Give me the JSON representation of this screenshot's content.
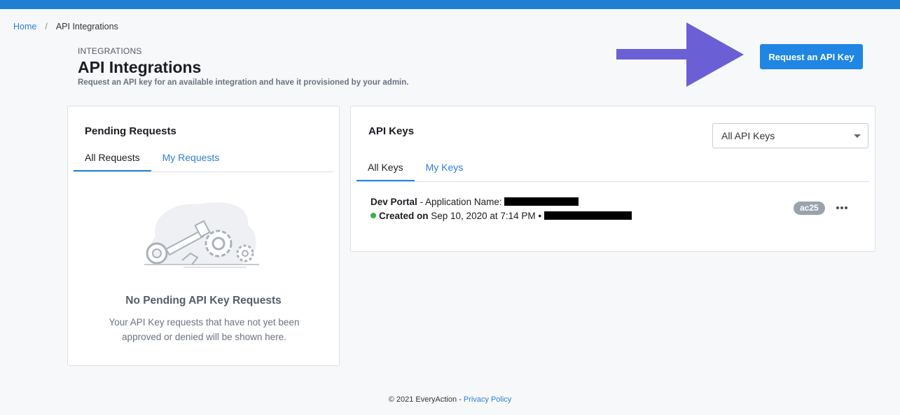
{
  "breadcrumb": {
    "home": "Home",
    "separator": "/",
    "current": "API Integrations"
  },
  "header": {
    "eyebrow": "INTEGRATIONS",
    "title": "API Integrations",
    "subtitle": "Request an API key for an available integration and have it provisioned by your admin."
  },
  "actions": {
    "request_button": "Request an API Key"
  },
  "pending": {
    "title": "Pending Requests",
    "tabs": [
      {
        "label": "All Requests"
      },
      {
        "label": "My Requests"
      }
    ],
    "empty_title": "No Pending API Key Requests",
    "empty_desc": "Your API Key requests that have not yet been approved or denied will be shown here."
  },
  "keys": {
    "title": "API Keys",
    "filter": {
      "selected": "All API Keys"
    },
    "tabs": [
      {
        "label": "All Keys"
      },
      {
        "label": "My Keys"
      }
    ],
    "items": [
      {
        "name": "Dev Portal",
        "app_label": " - Application Name: ",
        "created_label": "Created on",
        "created_date": " Sep 10, 2020 at 7:14 PM • ",
        "badge": "ac25"
      }
    ]
  },
  "footer": {
    "copyright": "© 2021 EveryAction - ",
    "privacy": "Privacy Policy"
  },
  "colors": {
    "topbar": "#1e7fd3",
    "primary": "#1f86e3",
    "arrow": "#6b5fd6",
    "status_active": "#36b24a",
    "badge": "#9aa3ad"
  },
  "icons": [
    "arrow-right-icon",
    "chevron-down-icon",
    "more-horizontal-icon",
    "key-gears-illustration"
  ]
}
